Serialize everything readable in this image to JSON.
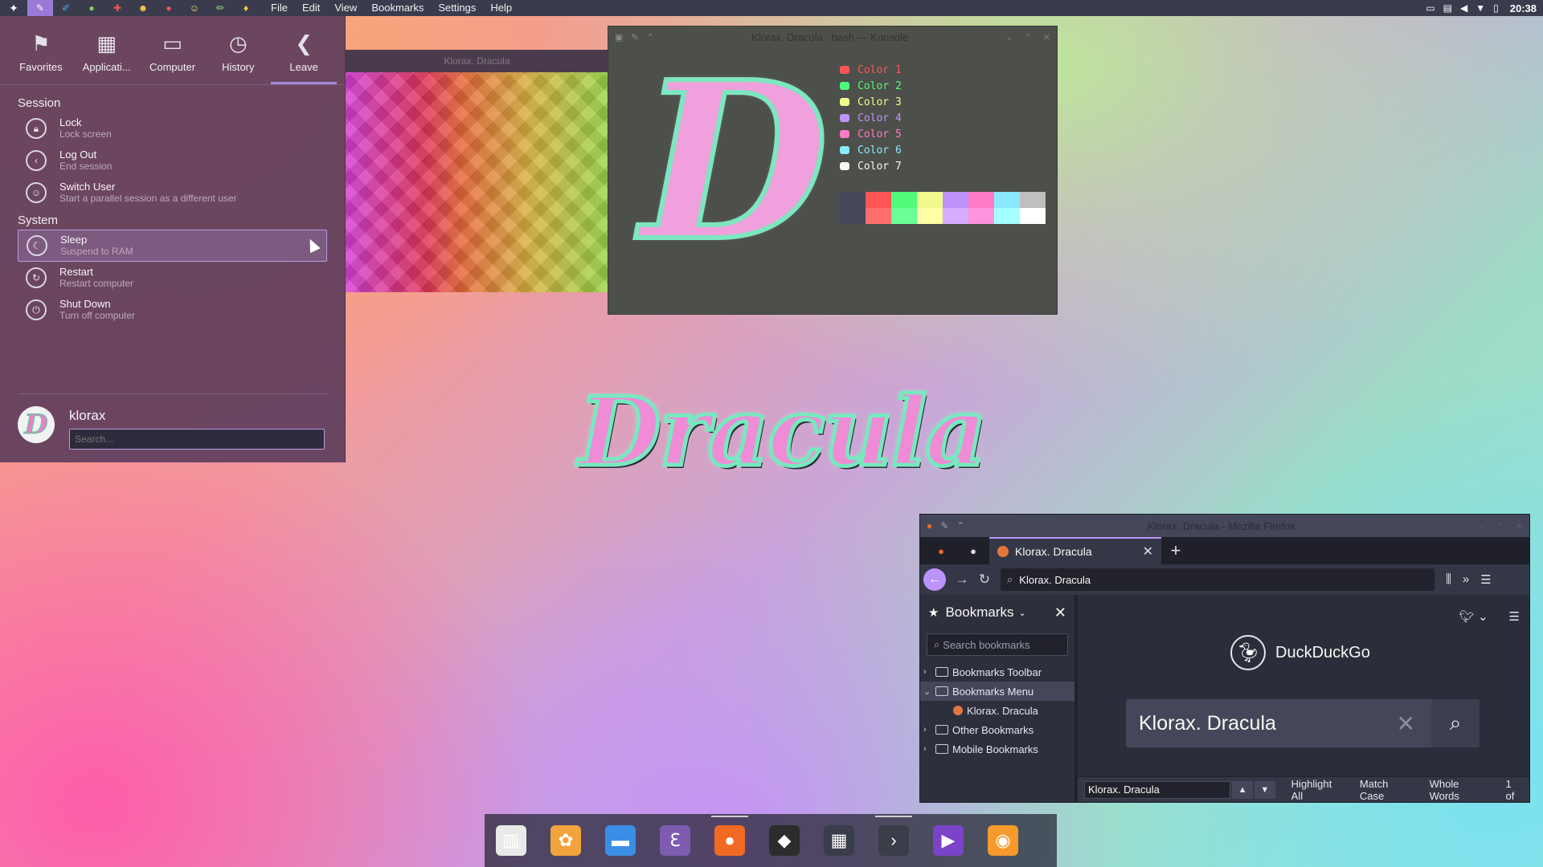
{
  "top_panel": {
    "menu": [
      "File",
      "Edit",
      "View",
      "Bookmarks",
      "Settings",
      "Help"
    ],
    "clock": "20:38",
    "launcher_icon": "kde-launcher-icon",
    "tray_icons": [
      "display-icon",
      "clipboard-icon",
      "volume-icon",
      "network-icon",
      "battery-icon"
    ]
  },
  "kickoff": {
    "tabs": [
      {
        "label": "Favorites",
        "icon": "bookmark-icon"
      },
      {
        "label": "Applicati...",
        "icon": "grid-icon"
      },
      {
        "label": "Computer",
        "icon": "monitor-icon"
      },
      {
        "label": "History",
        "icon": "clock-icon"
      },
      {
        "label": "Leave",
        "icon": "back-arrow-icon"
      }
    ],
    "session_heading": "Session",
    "session_items": [
      {
        "title": "Lock",
        "subtitle": "Lock screen"
      },
      {
        "title": "Log Out",
        "subtitle": "End session"
      },
      {
        "title": "Switch User",
        "subtitle": "Start a parallel session as a different user"
      }
    ],
    "system_heading": "System",
    "system_items": [
      {
        "title": "Sleep",
        "subtitle": "Suspend to RAM"
      },
      {
        "title": "Restart",
        "subtitle": "Restart computer"
      },
      {
        "title": "Shut Down",
        "subtitle": "Turn off computer"
      }
    ],
    "username": "klorax",
    "search_placeholder": "Search..."
  },
  "pattern_window": {
    "title": "Klorax. Dracula"
  },
  "konsole": {
    "title": "Klorax. Dracula : bash — Konsole",
    "color_lines": [
      {
        "label": "Color 1",
        "color": "#ff5555"
      },
      {
        "label": "Color 2",
        "color": "#50fa7b"
      },
      {
        "label": "Color 3",
        "color": "#f1fa8c"
      },
      {
        "label": "Color 4",
        "color": "#bd93f9"
      },
      {
        "label": "Color 5",
        "color": "#ff79c6"
      },
      {
        "label": "Color 6",
        "color": "#8be9fd"
      },
      {
        "label": "Color 7",
        "color": "#f8f8f2"
      }
    ],
    "palette_top": [
      "#44475a",
      "#ff5555",
      "#50fa7b",
      "#f1fa8c",
      "#bd93f9",
      "#ff79c6",
      "#8be9fd",
      "#bfbfbf"
    ],
    "palette_bottom": [
      "#44475a",
      "#ff6e6e",
      "#69ff94",
      "#ffffa5",
      "#d6acff",
      "#ff92df",
      "#a4ffff",
      "#ffffff"
    ]
  },
  "wallpaper_logo": "Dracula",
  "firefox": {
    "window_title": "Klorax. Dracula - Mozilla Firefox",
    "tab_title": "Klorax. Dracula",
    "url": "Klorax. Dracula",
    "sidebar": {
      "title": "Bookmarks",
      "search_placeholder": "Search bookmarks",
      "tree": [
        {
          "label": "Bookmarks Toolbar",
          "expanded": false,
          "child": false
        },
        {
          "label": "Bookmarks Menu",
          "expanded": true,
          "child": false
        },
        {
          "label": "Klorax. Dracula",
          "expanded": false,
          "child": true
        },
        {
          "label": "Other Bookmarks",
          "expanded": false,
          "child": false
        },
        {
          "label": "Mobile Bookmarks",
          "expanded": false,
          "child": false
        }
      ]
    },
    "page": {
      "brand": "DuckDuckGo",
      "query": "Klorax. Dracula"
    },
    "findbar": {
      "value": "Klorax. Dracula",
      "options": [
        "Highlight All",
        "Match Case",
        "Whole Words"
      ],
      "status": "1 of"
    }
  },
  "dock": {
    "items": [
      {
        "name": "archive-manager-icon",
        "color": "#e9e9e9",
        "running": false
      },
      {
        "name": "octopus-app-icon",
        "color": "#f2a43c",
        "running": false
      },
      {
        "name": "file-manager-icon",
        "color": "#3a8ee6",
        "running": false
      },
      {
        "name": "emacs-icon",
        "color": "#7d5cb0",
        "running": false
      },
      {
        "name": "firefox-icon",
        "color": "#f06a24",
        "running": true
      },
      {
        "name": "inkscape-icon",
        "color": "#2c2c2c",
        "running": false
      },
      {
        "name": "calculator-icon",
        "color": "#3a3d4a",
        "running": false
      },
      {
        "name": "terminal-icon",
        "color": "#3b3d48",
        "running": true
      },
      {
        "name": "media-player-icon",
        "color": "#7b43c7",
        "running": false
      },
      {
        "name": "orange-app-icon",
        "color": "#f69a2c",
        "running": false
      }
    ]
  }
}
